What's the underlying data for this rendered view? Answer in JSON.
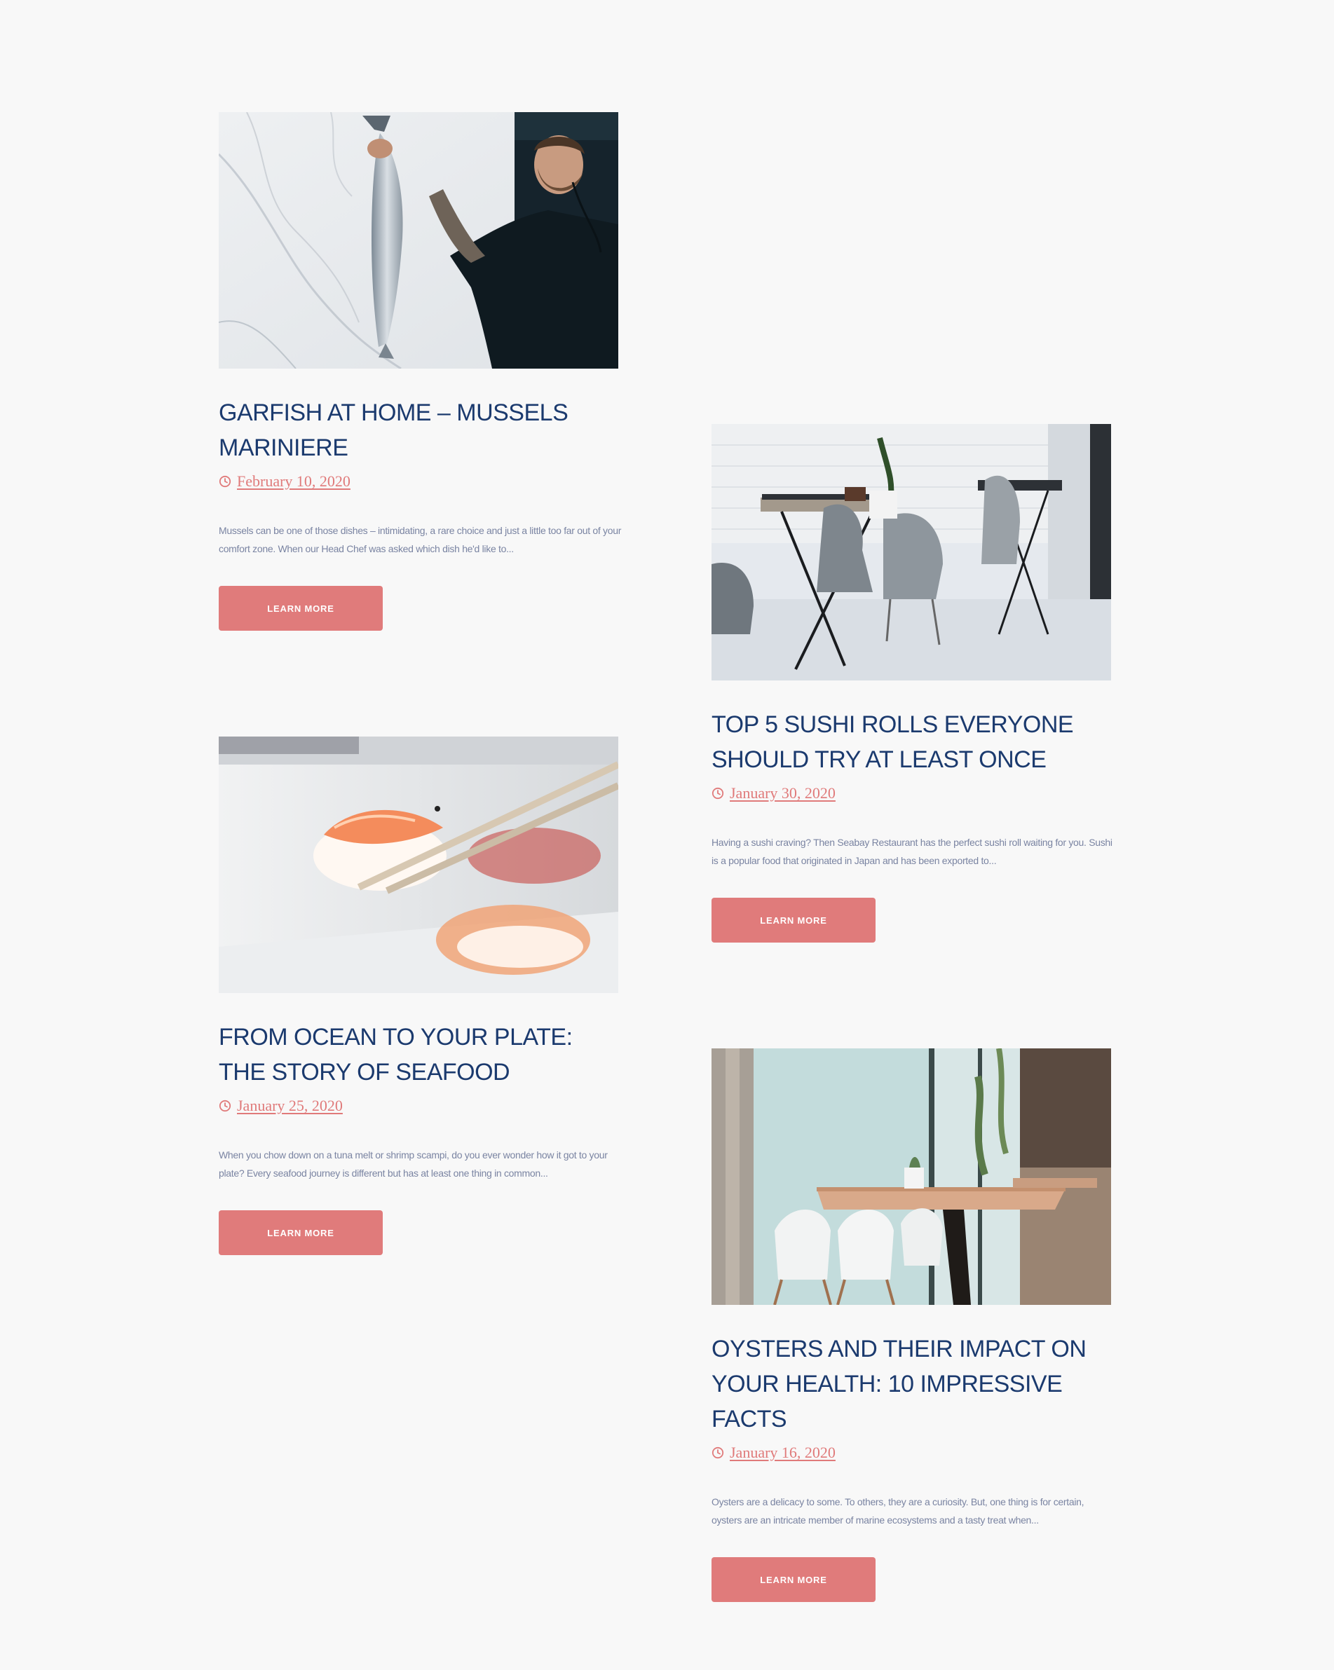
{
  "posts": [
    {
      "title": "GARFISH AT HOME – MUSSELS MARINIERE",
      "date": "February 10, 2020",
      "excerpt": "Mussels can be one of those dishes – intimidating, a rare choice and just a little too far out of your comfort zone. When our Head Chef was asked which dish he'd like to...",
      "button": "LEARN MORE"
    },
    {
      "title": "TOP 5 SUSHI ROLLS EVERYONE SHOULD TRY AT LEAST ONCE",
      "date": "January 30, 2020",
      "excerpt": "Having a sushi craving? Then Seabay Restaurant has the perfect sushi roll waiting for you. Sushi is a popular food that originated in Japan and has been exported to...",
      "button": "LEARN MORE"
    },
    {
      "title": "FROM OCEAN TO YOUR PLATE: THE STORY OF SEAFOOD",
      "date": "January 25, 2020",
      "excerpt": "When you chow down on a tuna melt or shrimp scampi, do you ever wonder how it got to your plate? Every seafood journey is different but has at least one thing in common...",
      "button": "LEARN MORE"
    },
    {
      "title": "OYSTERS AND THEIR IMPACT ON YOUR HEALTH: 10 IMPRESSIVE FACTS",
      "date": "January 16, 2020",
      "excerpt": "Oysters are a delicacy to some. To others, they are a curiosity. But, one thing is for certain, oysters are an intricate member of marine ecosystems and a tasty treat when...",
      "button": "LEARN MORE"
    }
  ],
  "colors": {
    "title": "#1b3a6e",
    "accent": "#e07b7b",
    "body_text": "#7a84a2",
    "background": "#f8f8f8"
  },
  "icons": {
    "date_icon": "clock-icon"
  }
}
